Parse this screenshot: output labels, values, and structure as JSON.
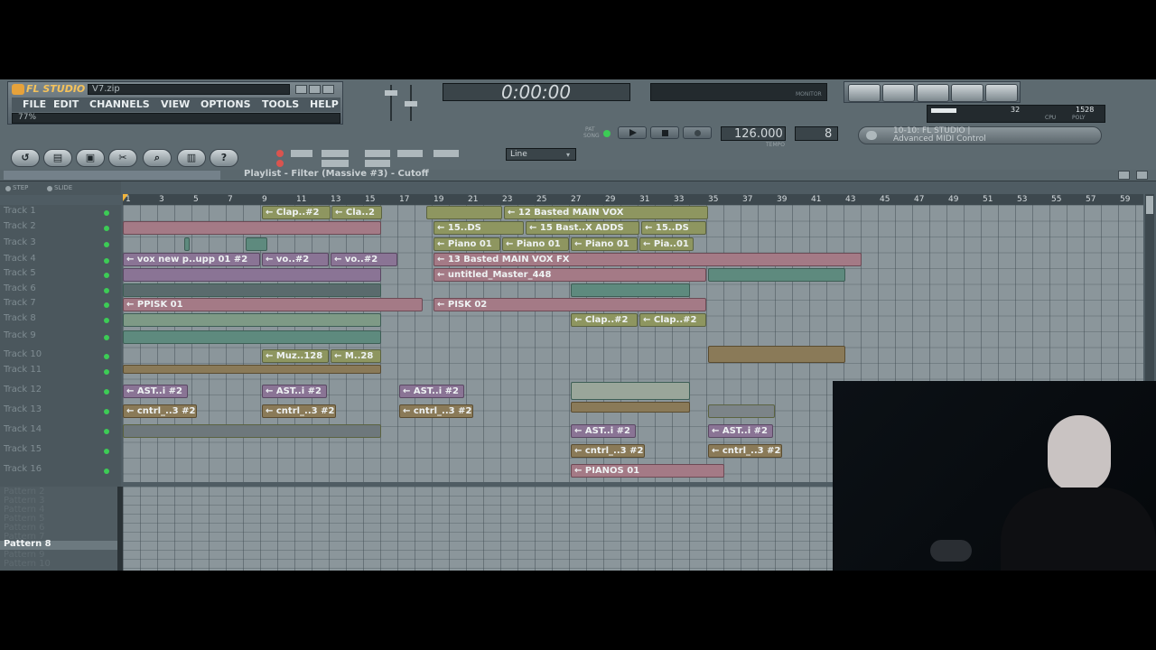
{
  "app": {
    "logo": "FL STUDIO",
    "file_name": "V7.zip",
    "hint": "77%",
    "menu": [
      "FILE",
      "EDIT",
      "CHANNELS",
      "VIEW",
      "OPTIONS",
      "TOOLS",
      "HELP"
    ]
  },
  "transport": {
    "time": "0:00:00",
    "tempo": "126.000",
    "tempo_label": "TEMPO",
    "pattern_num": "8",
    "pat_label": "PAT",
    "song_label": "SONG",
    "monitor_label": "MONITOR",
    "cpu_num": "32",
    "ram_num": "1528",
    "cpu_label": "CPU",
    "poly_label": "POLY"
  },
  "midi_panel": {
    "line1": "10-10: FL STUDIO |",
    "line2": "Advanced MIDI Control"
  },
  "snap": {
    "value": "Line"
  },
  "playlist": {
    "title": "Playlist - Filter (Massive #3) - Cutoff",
    "step_label": "STEP",
    "slide_label": "SLIDE",
    "ruler": [
      "1",
      "3",
      "5",
      "7",
      "9",
      "11",
      "13",
      "15",
      "17",
      "19",
      "21",
      "23",
      "25",
      "27",
      "29",
      "31",
      "33",
      "35",
      "37",
      "39",
      "41",
      "43",
      "45",
      "47",
      "49",
      "51",
      "53",
      "55",
      "57",
      "59"
    ],
    "tracks": [
      "Track 1",
      "Track 2",
      "Track 3",
      "Track 4",
      "Track 5",
      "Track 6",
      "Track 7",
      "Track 8",
      "Track 9",
      "Track 10",
      "Track 11",
      "Track 12",
      "Track 13",
      "Track 14",
      "Track 15",
      "Track 16"
    ],
    "clips": {
      "clap2a": "Clap..#2",
      "cla2": "Cla..2",
      "basted_main_vox": "12 Basted MAIN VOX",
      "ds_a": "15..DS",
      "bast_x_adds": "15 Bast..X ADDS",
      "ds_b": "15..DS",
      "piano1": "Piano 01",
      "piano2": "Piano 01",
      "piano3": "Piano 01",
      "pia01": "Pia..01",
      "vox_new": "vox new p..upp 01 #2",
      "vo2a": "vo..#2",
      "vo2b": "vo..#2",
      "basted_vox_fx": "13 Basted MAIN VOX FX",
      "untitled_master": "untitled_Master_448",
      "ppisk": "PPISK 01",
      "pisk2": "PISK 02",
      "clap2b": "Clap..#2",
      "clap2c": "Clap..#2",
      "muz128": "Muz..128",
      "m28": "M..28",
      "ast_a": "AST..i #2",
      "ast_b": "AST..i #2",
      "ast_c": "AST..i #2",
      "ast_d": "AST..i #2",
      "ast_e": "AST..i #2",
      "cntrl_a": "cntrl_..3 #2",
      "cntrl_b": "cntrl_..3 #2",
      "cntrl_c": "cntrl_..3 #2",
      "cntrl_d": "cntrl_..3 #2",
      "cntrl_e": "cntrl_..3 #2",
      "pianos": "PIANOS 01"
    },
    "patterns": [
      "Pattern 2",
      "Pattern 3",
      "Pattern 4",
      "Pattern 5",
      "Pattern 6",
      "Pattern 7",
      "Pattern 8",
      "Pattern 9",
      "Pattern 10"
    ],
    "selected_pattern": "Pattern 8"
  },
  "colors": {
    "accent_green": "#3ccc55",
    "toolbar_bg": "#5d6a70",
    "grid_bg": "#8b969b"
  }
}
